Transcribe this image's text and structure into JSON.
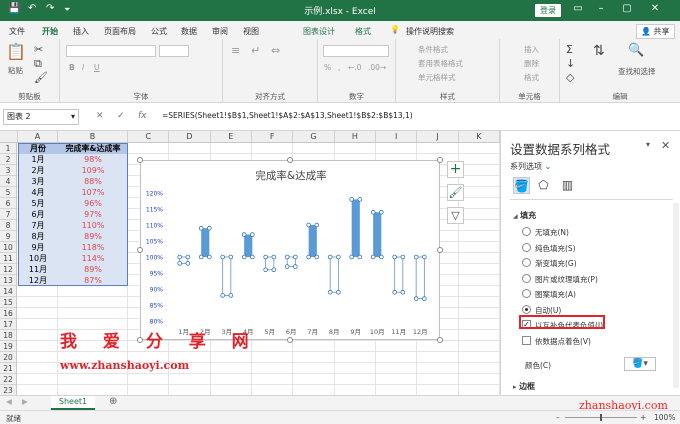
{
  "titlebar": {
    "filename": "示例.xlsx",
    "sep": "-",
    "app": "Excel",
    "login": "登录",
    "save_icon": "💾",
    "undo_icon": "↶",
    "redo_icon": "↷",
    "customize_icon": "⏷",
    "ribbon_opts_icon": "▭",
    "min_icon": "–",
    "max_icon": "▢",
    "close_icon": "✕"
  },
  "tabs": {
    "items": [
      "文件",
      "开始",
      "插入",
      "页面布局",
      "公式",
      "数据",
      "审阅",
      "视图",
      "图表设计",
      "格式"
    ],
    "tell_me": "操作说明搜索",
    "tell_me_icon": "💡",
    "share": "共享",
    "share_icon": "👤"
  },
  "ribbon": {
    "paste": "粘贴",
    "clipboard": "剪贴板",
    "font": "字体",
    "align": "对齐方式",
    "number": "数字",
    "styles": "样式",
    "cells": "单元格",
    "editing": "编辑",
    "cond_format": "条件格式",
    "table_format": "套用表格格式",
    "cell_styles": "单元格样式",
    "insert": "插入",
    "delete": "删除",
    "format": "格式",
    "find_select": "查找和选择",
    "bold": "B",
    "italic": "I",
    "underline": "U",
    "percent": "%",
    "comma": ",",
    "increase_decimal": "←.0",
    "decrease_decimal": ".00→",
    "paste_icon": "📋",
    "cut_icon": "✂",
    "copy_icon": "⧉",
    "brush_icon": "🖌",
    "align_icon": "≡",
    "wrap_icon": "↵",
    "merge_icon": "⇔",
    "autosum_icon": "Σ",
    "fill_icon": "↓",
    "clear_icon": "◇",
    "sort_icon": "⇅",
    "find_icon": "🔍"
  },
  "formula_bar": {
    "name_box": "图表 2",
    "name_dropdown_icon": "▾",
    "cancel": "✕",
    "enter": "✓",
    "fx": "fx",
    "formula": "=SERIES(Sheet1!$B$1,Sheet1!$A$2:$A$13,Sheet1!$B$2:$B$13,1)"
  },
  "grid": {
    "columns": [
      "A",
      "B",
      "C",
      "D",
      "E",
      "F",
      "G",
      "H",
      "I",
      "J",
      "K"
    ],
    "rows": [
      "1",
      "2",
      "3",
      "4",
      "5",
      "6",
      "7",
      "8",
      "9",
      "10",
      "11",
      "12",
      "13",
      "14",
      "15",
      "16",
      "17",
      "18",
      "19",
      "20",
      "21",
      "22",
      "23"
    ],
    "header_a": "月份",
    "header_b": "完成率&达成率",
    "months": [
      "1月",
      "2月",
      "3月",
      "4月",
      "5月",
      "6月",
      "7月",
      "8月",
      "9月",
      "10月",
      "11月",
      "12月"
    ],
    "rates": [
      "98%",
      "109%",
      "88%",
      "107%",
      "96%",
      "97%",
      "110%",
      "89%",
      "118%",
      "114%",
      "89%",
      "87%"
    ]
  },
  "chart_data": {
    "type": "bar",
    "title": "完成率&达成率",
    "categories": [
      "1月",
      "2月",
      "3月",
      "4月",
      "5月",
      "6月",
      "7月",
      "8月",
      "9月",
      "10月",
      "11月",
      "12月"
    ],
    "values": [
      0.98,
      1.09,
      0.88,
      1.07,
      0.96,
      0.97,
      1.1,
      0.89,
      1.18,
      1.14,
      0.89,
      0.87
    ],
    "base": 1.0,
    "ylim": [
      0.8,
      1.2
    ],
    "yticks": [
      "80%",
      "85%",
      "90%",
      "95%",
      "100%",
      "105%",
      "110%",
      "115%",
      "120%"
    ],
    "positive_color": "#5b9bd5",
    "negative_color": "#ffffff",
    "gridlines": false,
    "legend": "none",
    "plus_icon": "+",
    "brush_icon": "🖌",
    "filter_icon": "▽"
  },
  "watermark": {
    "cn": "我 爱 分 享 网",
    "url": "www.zhanshaoyi.com",
    "corner": "zhanshaoyi.com"
  },
  "pane": {
    "title": "设置数据系列格式",
    "series_options": "系列选项",
    "series_dropdown_icon": "⌄",
    "fill_section": "填充",
    "fill_section_icon": "◢",
    "options": [
      "无填充(N)",
      "纯色填充(S)",
      "渐变填充(G)",
      "图片或纹理填充(P)",
      "图案填充(A)",
      "自动(U)"
    ],
    "selected_option": 5,
    "invert_label": "以互补色代表负值(I)",
    "vary_label": "依数据点着色(V)",
    "color_label": "颜色(C)",
    "border_section": "边框",
    "border_section_icon": "▸",
    "fill_icon": "🪣",
    "effects_icon": "⬠",
    "series_icon": "▥",
    "close_icon": "✕",
    "pane_dropdown_icon": "▾",
    "check": "✓",
    "color_icon": "🪣▾"
  },
  "sheets": {
    "active": "Sheet1",
    "add_icon": "⊕",
    "prev_icon": "◀",
    "next_icon": "▶"
  },
  "status": {
    "ready": "就绪",
    "zoom": "100%",
    "zoom_minus": "–",
    "zoom_plus": "+"
  }
}
